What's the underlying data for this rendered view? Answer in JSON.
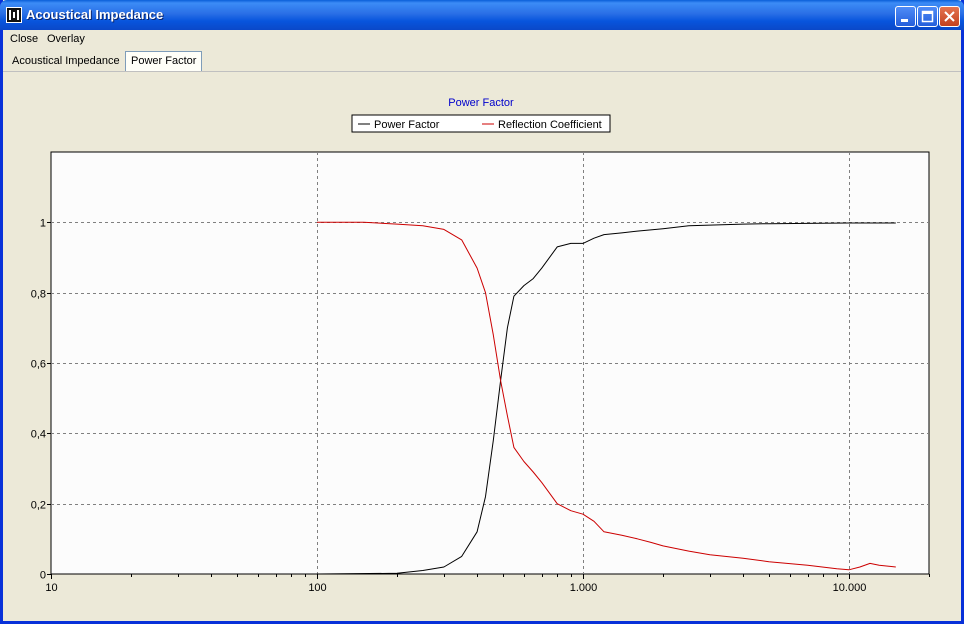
{
  "window": {
    "title": "Acoustical Impedance",
    "icon": "app-logo-icon",
    "controls": {
      "minimize": "minimize-icon",
      "maximize": "maximize-icon",
      "close": "close-icon"
    }
  },
  "menu": {
    "items": [
      "Close",
      "Overlay"
    ]
  },
  "tabs": [
    {
      "label": "Acoustical Impedance",
      "active": false
    },
    {
      "label": "Power Factor",
      "active": true
    }
  ],
  "colors": {
    "title_text": "#0000cc",
    "power_factor": "#000000",
    "reflection": "#cc0000",
    "plot_bg": "#fcfcfc",
    "grid": "#808080"
  },
  "chart_data": {
    "type": "line",
    "title": "Power Factor",
    "xlabel": "",
    "ylabel": "",
    "xscale": "log",
    "xlim": [
      10,
      20000
    ],
    "ylim": [
      0,
      1.2
    ],
    "xticks": [
      10,
      100,
      1000,
      10000
    ],
    "xtick_labels": [
      "10",
      "100",
      "1.000",
      "10.000"
    ],
    "yticks": [
      0,
      0.2,
      0.4,
      0.6,
      0.8,
      1
    ],
    "ytick_labels": [
      "0",
      "0,2",
      "0,4",
      "0,6",
      "0,8",
      "1"
    ],
    "grid": true,
    "legend": "top-center",
    "series": [
      {
        "name": "Power Factor",
        "color": "#000000",
        "points": [
          [
            10,
            0
          ],
          [
            100,
            0
          ],
          [
            200,
            0.002
          ],
          [
            250,
            0.01
          ],
          [
            300,
            0.02
          ],
          [
            350,
            0.05
          ],
          [
            400,
            0.12
          ],
          [
            430,
            0.22
          ],
          [
            460,
            0.38
          ],
          [
            490,
            0.55
          ],
          [
            520,
            0.7
          ],
          [
            550,
            0.79
          ],
          [
            600,
            0.82
          ],
          [
            650,
            0.84
          ],
          [
            700,
            0.87
          ],
          [
            800,
            0.93
          ],
          [
            900,
            0.94
          ],
          [
            1000,
            0.94
          ],
          [
            1100,
            0.955
          ],
          [
            1200,
            0.965
          ],
          [
            1400,
            0.97
          ],
          [
            1600,
            0.975
          ],
          [
            2000,
            0.982
          ],
          [
            2500,
            0.99
          ],
          [
            3000,
            0.992
          ],
          [
            4000,
            0.995
          ],
          [
            5000,
            0.996
          ],
          [
            7000,
            0.997
          ],
          [
            10000,
            0.998
          ],
          [
            15000,
            0.998
          ]
        ]
      },
      {
        "name": "Reflection Coefficient",
        "color": "#cc0000",
        "points": [
          [
            100,
            1
          ],
          [
            150,
            1
          ],
          [
            200,
            0.995
          ],
          [
            250,
            0.99
          ],
          [
            300,
            0.98
          ],
          [
            350,
            0.95
          ],
          [
            400,
            0.87
          ],
          [
            430,
            0.8
          ],
          [
            460,
            0.68
          ],
          [
            490,
            0.55
          ],
          [
            520,
            0.45
          ],
          [
            550,
            0.36
          ],
          [
            600,
            0.32
          ],
          [
            650,
            0.29
          ],
          [
            700,
            0.26
          ],
          [
            800,
            0.2
          ],
          [
            900,
            0.18
          ],
          [
            1000,
            0.17
          ],
          [
            1100,
            0.15
          ],
          [
            1200,
            0.12
          ],
          [
            1400,
            0.11
          ],
          [
            1600,
            0.1
          ],
          [
            1800,
            0.09
          ],
          [
            2000,
            0.08
          ],
          [
            2500,
            0.065
          ],
          [
            3000,
            0.055
          ],
          [
            4000,
            0.045
          ],
          [
            5000,
            0.035
          ],
          [
            7000,
            0.025
          ],
          [
            9000,
            0.015
          ],
          [
            10000,
            0.012
          ],
          [
            11000,
            0.02
          ],
          [
            12000,
            0.03
          ],
          [
            13000,
            0.025
          ],
          [
            15000,
            0.02
          ]
        ]
      }
    ]
  }
}
